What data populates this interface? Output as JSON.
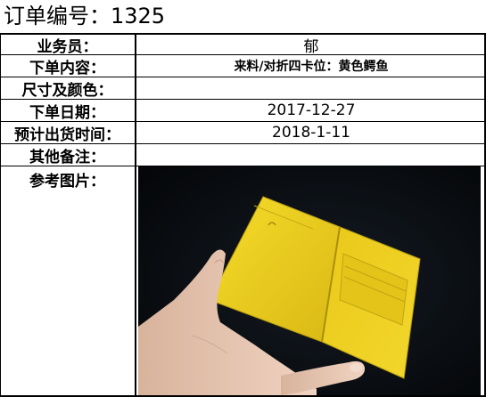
{
  "order": {
    "title_label": "订单编号：",
    "number": "1325"
  },
  "rows": [
    {
      "label": "业务员：",
      "value": "郁"
    },
    {
      "label": "下单内容：",
      "value": "来料/对折四卡位：黄色鳄鱼"
    },
    {
      "label": "尺寸及颜色：",
      "value": ""
    },
    {
      "label": "下单日期：",
      "value": "2017-12-27"
    },
    {
      "label": "预计出货时间：",
      "value": "2018-1-11"
    },
    {
      "label": "其他备注：",
      "value": ""
    },
    {
      "label": "参考图片："
    }
  ],
  "photo": {
    "subject": "yellow bifold card holder held in hand",
    "wallet_color": "#f2d31b",
    "background_color": "#0c1117",
    "skin_color": "#e8c6b2"
  }
}
